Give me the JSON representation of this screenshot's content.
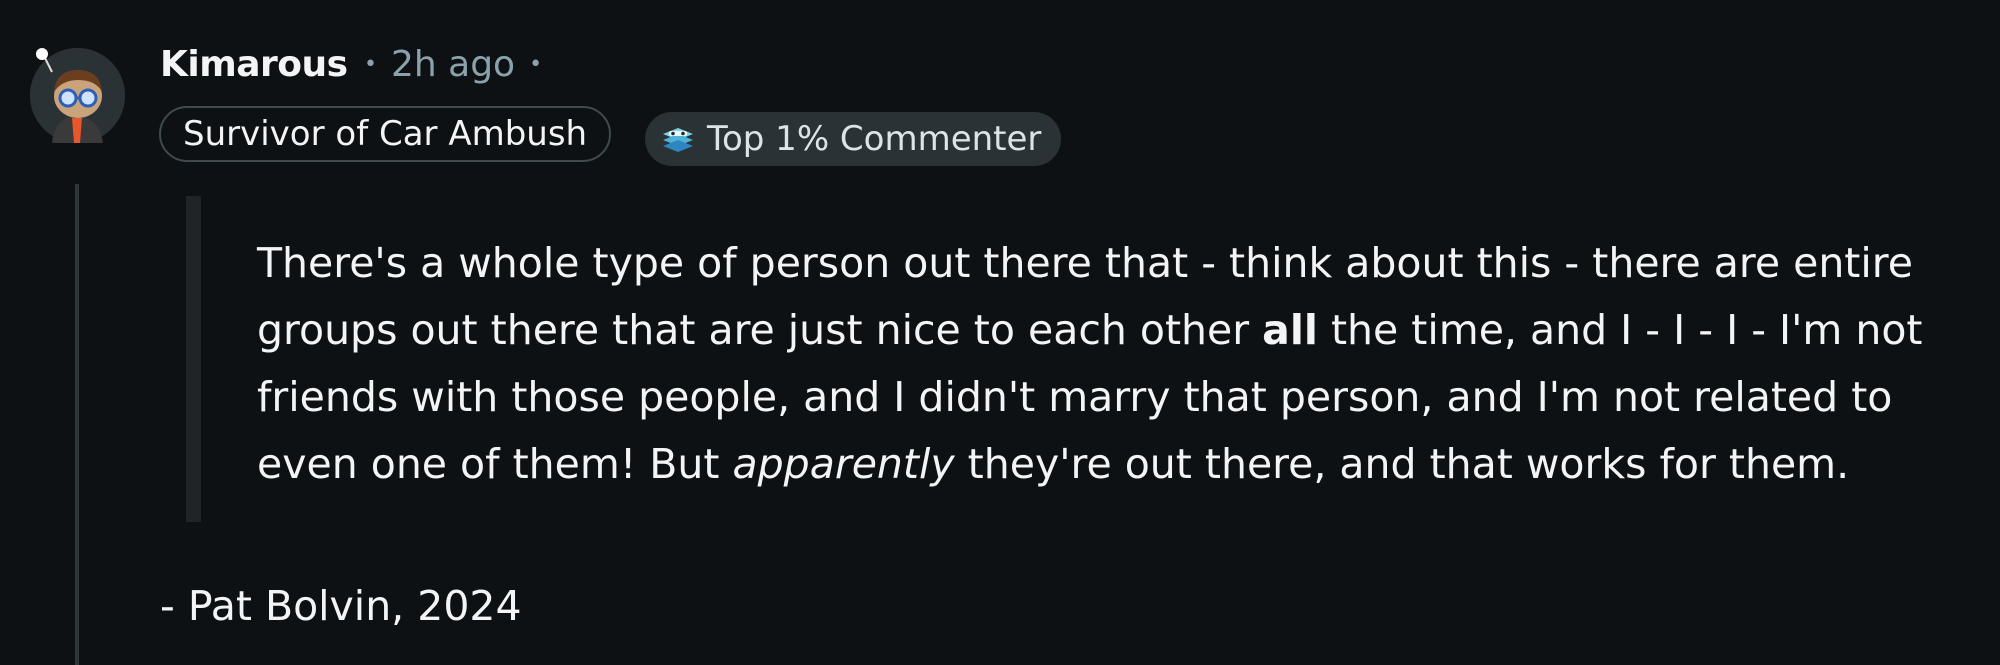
{
  "comment": {
    "username": "Kimarous",
    "timestamp": "2h ago",
    "separator": "•",
    "flairs": {
      "user_flair": "Survivor of Car Ambush",
      "achievement_flair": "Top 1% Commenter",
      "achievement_icon": "commenter-trophy-icon"
    },
    "quote": {
      "part1": "There's a whole type of person out there that - think about this - there are entire groups out there that are just nice to each other ",
      "bold": "all",
      "part2": " the time, and I - I - I - I'm not friends with those people, and I didn't marry that person, and I'm not related to even one of them! But ",
      "italic": "apparently",
      "part3": " they're out there, and that works for them."
    },
    "attribution": "- Pat Bolvin, 2024"
  },
  "colors": {
    "background": "#0e1113",
    "text": "#f2f4f5",
    "meta": "#8ba2ad",
    "flair_border": "#3e4a4f",
    "flair_fill": "#2a3236",
    "thread_line": "#2e363a",
    "quote_bar": "#1f2426"
  }
}
